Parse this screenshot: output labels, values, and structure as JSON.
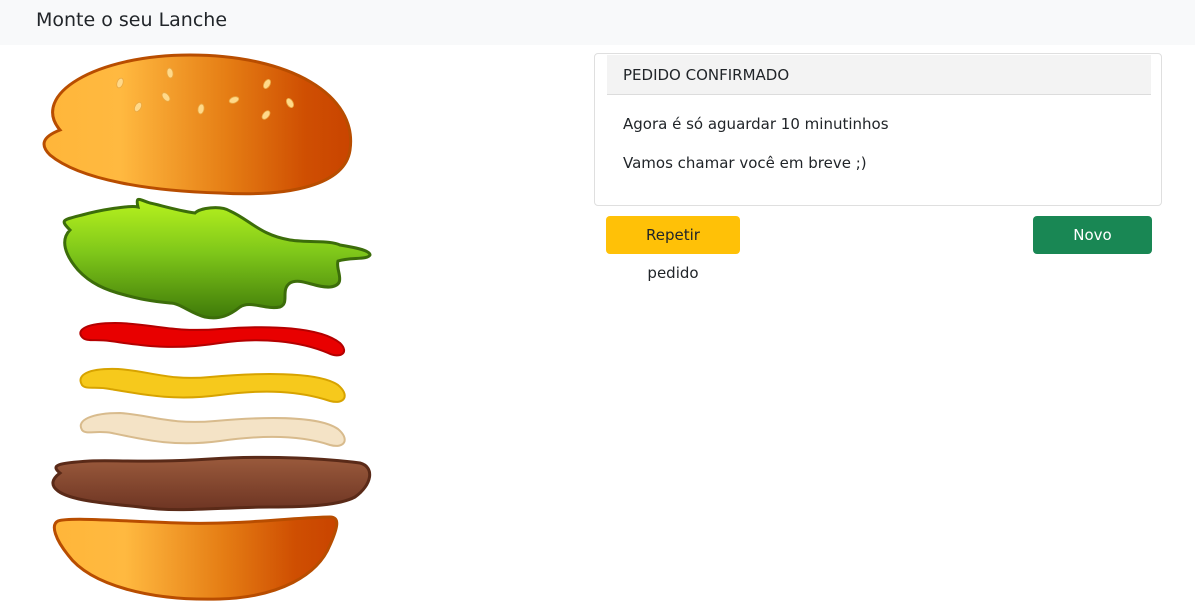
{
  "navbar": {
    "brand": "Monte o seu Lanche"
  },
  "card": {
    "header": "PEDIDO CONFIRMADO",
    "lines": [
      "Agora é só aguardar 10 minutinhos",
      "Vamos chamar você em breve ;)"
    ]
  },
  "actions": {
    "repeat_label": "Repetir pedido",
    "new_label": "Novo pedido"
  },
  "burger": {
    "layers": [
      "top-bun-icon",
      "lettuce-icon",
      "ketchup-icon",
      "mustard-icon",
      "mayo-icon",
      "patty-icon",
      "bottom-bun-icon"
    ]
  },
  "colors": {
    "navbar_bg": "#f8f9fa",
    "warning": "#ffc107",
    "success": "#198754",
    "bun_light": "#ffb63a",
    "bun_dark": "#c94400",
    "lettuce": "#79c51a",
    "ketchup": "#e10000",
    "mustard": "#f5c518",
    "mayo": "#f4e2c4",
    "patty": "#7a3f2a"
  }
}
